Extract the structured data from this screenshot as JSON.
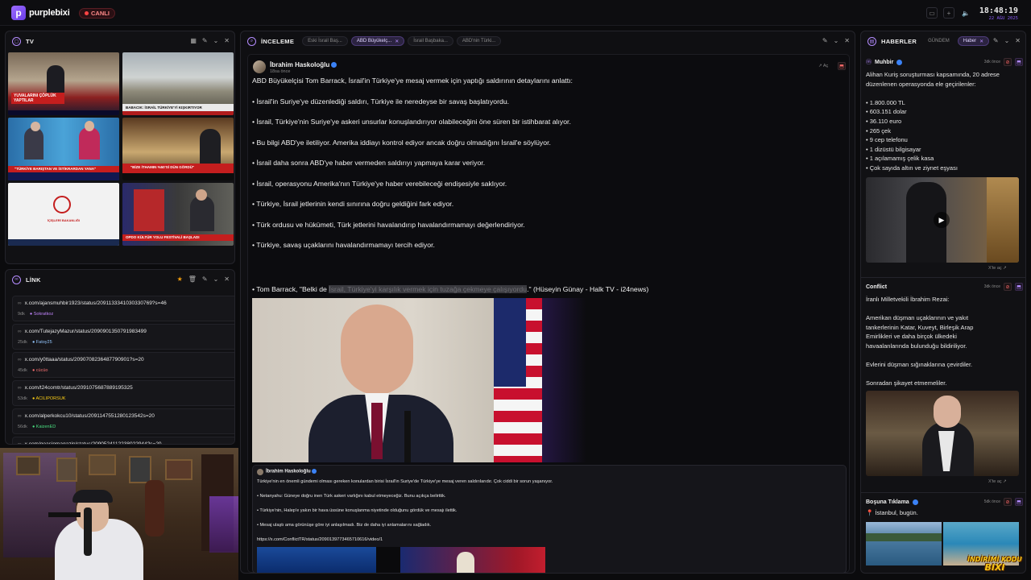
{
  "app": {
    "brand": "purplebixi",
    "live_label": "CANLI"
  },
  "clock": {
    "time": "18:48:19",
    "date": "22 AĞU 2025"
  },
  "tv_panel": {
    "title": "TV"
  },
  "link_panel": {
    "title": "LİNK",
    "items": [
      {
        "url": "x.com/ajansmuhbir1923/status/2091133341030330769?s=46",
        "age": "9dk",
        "user": "Sokratkoz",
        "user_color": "#c084fc"
      },
      {
        "url": "x.com/TutejazyMazur/status/2090901350791983499",
        "age": "25dk",
        "user": "Fatoy25",
        "user_color": "#93c5fd"
      },
      {
        "url": "x.com/y0ttaaa/status/2090708236487790901?s=20",
        "age": "45dk",
        "user": "cücüo",
        "user_color": "#f87171"
      },
      {
        "url": "x.com/t24comtr/status/2091075687889195325",
        "age": "53dk",
        "user": "ACILIPORSUK",
        "user_color": "#facc15"
      },
      {
        "url": "x.com/alperkokcu10/status/2091147551280123542s=20",
        "age": "56dk",
        "user": "KaizenED",
        "user_color": "#4ade80"
      },
      {
        "url": "x.com/qoasipmagazin/status/2090524112238022944?s=20",
        "age": "",
        "user": "",
        "user_color": "#888888"
      }
    ]
  },
  "inceleme": {
    "title": "İNCELEME",
    "tabs": [
      {
        "label": "Eski İsrail Baş...",
        "active": false
      },
      {
        "label": "ABD Büyükelç...",
        "active": true
      },
      {
        "label": "İsrail Başbaka...",
        "active": false
      },
      {
        "label": "ABD'nin Türki...",
        "active": false
      }
    ],
    "author": "İbrahim Haskoloğlu",
    "time": "18sa önce",
    "open_label": "Aç",
    "lines": [
      "ABD Büyükelçisi Tom Barrack, İsrail'in Türkiye'ye mesaj vermek için yaptığı saldırının detaylarını anlattı:",
      "• İsrail'in Suriye'ye düzenlediği saldırı, Türkiye ile neredeyse bir savaş başlatıyordu.",
      "• İsrail, Türkiye'nin Suriye'ye askeri unsurlar konuşlandırıyor olabileceğini öne süren bir istihbarat alıyor.",
      "• Bu bilgi ABD'ye iletiliyor. Amerika iddiayı kontrol ediyor ancak doğru olmadığını İsrail'e söylüyor.",
      "• İsrail daha sonra ABD'ye haber vermeden saldırıyı yapmaya karar veriyor.",
      "• İsrail, operasyonu Amerika'nın Türkiye'ye haber verebileceği endişesiyle saklıyor.",
      "• Türkiye, İsrail jetlerinin kendi sınırına doğru geldiğini fark ediyor.",
      "• Türk ordusu ve hükümeti, Türk jetlerini havalandırıp havalandırmamayı değerlendiriyor.",
      "• Türkiye, savaş uçaklarını havalandırmamayı tercih ediyor."
    ],
    "last_line_pre": "• Tom Barrack, \"Belki de ",
    "last_line_hl": "İsrail, Türkiye'yi karşılık vermek için tuzağa çekmeye çalışıyordu",
    "last_line_post": ".\" (Hüseyin Günay - Halk TV - i24news)",
    "quote": {
      "author": "İbrahim Haskoloğlu",
      "lines": [
        "Türkiye'nin en önemli gündemi olması gereken konulardan birisi İsrail'in Suriye'de Türkiye'ye mesaj veren saldırılarıdır. Çok ciddi bir sorun yaşanıyor.",
        "• Netanyahu: Güneye doğru inen Türk askeri varlığını kabul etmeyeceğiz. Bunu açıkça belirttik.",
        "• Türkiye'nin, Halep'e yakın bir hava üssüne konuşlanma niyetinde olduğunu gördük ve mesajı ilettik.",
        "• Mesaj ulaştı ama görünüşe göre iyi anlaşılmadı. Biz de daha iyi anlamalarını sağladık.",
        "https://x.com/ConflictTR/status/2090139773465710616/video/1"
      ]
    }
  },
  "haberler": {
    "title": "HABERLER",
    "chips": [
      {
        "label": "GÜNDEM",
        "active": false
      },
      {
        "label": "Haber",
        "active": true
      }
    ],
    "cards": [
      {
        "name": "Muhbir",
        "age": "3dk önce",
        "body": [
          "Alihan Kuriş soruşturması kapsamında, 20 adrese",
          "düzenlenen operasyonda ele geçirilenler:",
          "",
          "• 1.800.000 TL",
          "• 603.151 dolar",
          "• 36.110 euro",
          "• 265 çek",
          "• 9 cep telefonu",
          "• 1 dizüstü bilgisayar",
          "• 1 açılamamış çelik kasa",
          "• Çok sayıda altın ve ziynet eşyası"
        ],
        "open": "X'te aç"
      },
      {
        "name": "Conflict",
        "age": "3dk önce",
        "body": [
          "İranlı Milletvekili İbrahim Rezai:",
          "",
          "Amerikan düşman uçaklarının ve yakıt",
          "tankerlerinin Katar, Kuveyt, Birleşik Arap",
          "Emirlikleri ve daha birçok ülkedeki",
          "havaalanlarında bulunduğu bildiriliyor.",
          "",
          "Evlerini düşman sığınaklarına çevirdiler.",
          "",
          "Sonradan şikayet etmemeliler."
        ],
        "open": "X'te aç"
      },
      {
        "name": "Boşuna Tıklama",
        "age": "5dk önce",
        "body": [
          "📍 İstanbul, bugün."
        ],
        "open": ""
      }
    ]
  },
  "tv_tiles": [
    {
      "caption": "YUVALARINI ÇÖPLÜK YAPTILAR"
    },
    {
      "caption": "BABACIK: İSRAİL TÜRKİYE'Yİ KIŞKIRTIYOR"
    },
    {
      "caption": "\"TÜRKİYE BARIŞTAN VE İSTİKRARDAN YANA\""
    },
    {
      "caption": "\"BİZE İTHAMIN %50'Sİ DÜN GÖRDÜ\""
    },
    {
      "caption": "İÇİŞLERİ BAKANLIĞI"
    },
    {
      "caption": "OPDO KÜLTÜR YOLU FESTİVALİ BAŞLADI"
    }
  ],
  "overlay": {
    "line1": "İNDİRİMİ KODU",
    "line2": "BIXI"
  }
}
